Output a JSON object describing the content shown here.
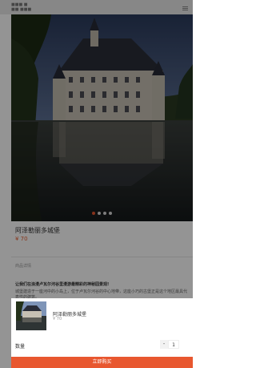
{
  "status": {
    "text": "■■■ ■\n■■ ■■■"
  },
  "product": {
    "title": "阿泽勒丽多城堡",
    "price": "¥ 70",
    "tab": "商品详情",
    "desc_title": "让我们在浪漫卢瓦尔河谷里漫游最精彩的神秘园景观!",
    "desc": "城堡建造于一座河中的小岛上，位于卢瓦尔河谷的中心地带，这座小巧的古堡正是这个地区最具代表性的建筑。"
  },
  "carousel": {
    "total": 4,
    "active": 0
  },
  "sheet": {
    "name": "阿泽勒丽多城堡",
    "price": "¥ 70",
    "qty_label": "数量",
    "minus": "-",
    "qty": "1",
    "buy_label": "立即购买"
  },
  "colors": {
    "accent": "#e8572f"
  }
}
